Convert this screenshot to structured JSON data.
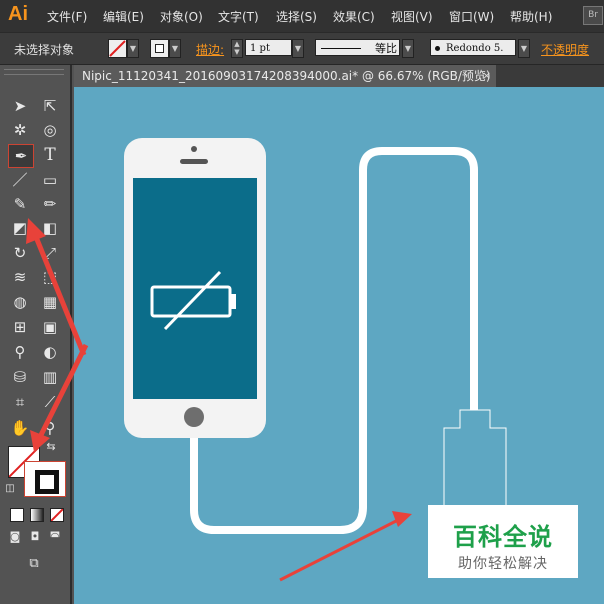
{
  "app": {
    "logo": "Ai",
    "bridge_button": "Br"
  },
  "menu": [
    "文件(F)",
    "编辑(E)",
    "对象(O)",
    "文字(T)",
    "选择(S)",
    "效果(C)",
    "视图(V)",
    "窗口(W)",
    "帮助(H)"
  ],
  "control_bar": {
    "selection_status": "未选择对象",
    "stroke_label": "描边:",
    "stroke_weight": "1 pt",
    "stroke_profile": "等比",
    "brush": "Redondo 5.",
    "opacity_label": "不透明度"
  },
  "document_tab": {
    "title": "Nipic_11120341_20160903174208394000.ai* @ 66.67% (RGB/预览)",
    "close": "×"
  },
  "toolbar": {
    "tools": [
      "selection-tool",
      "direct-selection-tool",
      "magic-wand-tool",
      "lasso-tool",
      "pen-tool",
      "type-tool",
      "line-tool",
      "rectangle-tool",
      "paintbrush-tool",
      "pencil-tool",
      "blob-brush-tool",
      "eraser-tool",
      "rotate-tool",
      "scale-tool",
      "width-tool",
      "free-transform-tool",
      "shape-builder-tool",
      "perspective-grid-tool",
      "mesh-tool",
      "gradient-tool",
      "eyedropper-tool",
      "blend-tool",
      "symbol-sprayer-tool",
      "column-graph-tool",
      "artboard-tool",
      "slice-tool",
      "hand-tool",
      "zoom-tool"
    ],
    "active_tool": "pen-tool",
    "fill_color": "#ffffff",
    "stroke_color": "#000000"
  },
  "watermark": {
    "title": "百科全说",
    "subtitle": "助你轻松解决"
  },
  "colors": {
    "artboard_bg": "#5ea7c2",
    "phone_body": "#f3f3f3",
    "phone_screen": "#0b6d8a",
    "annotation_arrow": "#e8423a",
    "accent_orange": "#f7941d",
    "watermark_green": "#1ea04a"
  }
}
